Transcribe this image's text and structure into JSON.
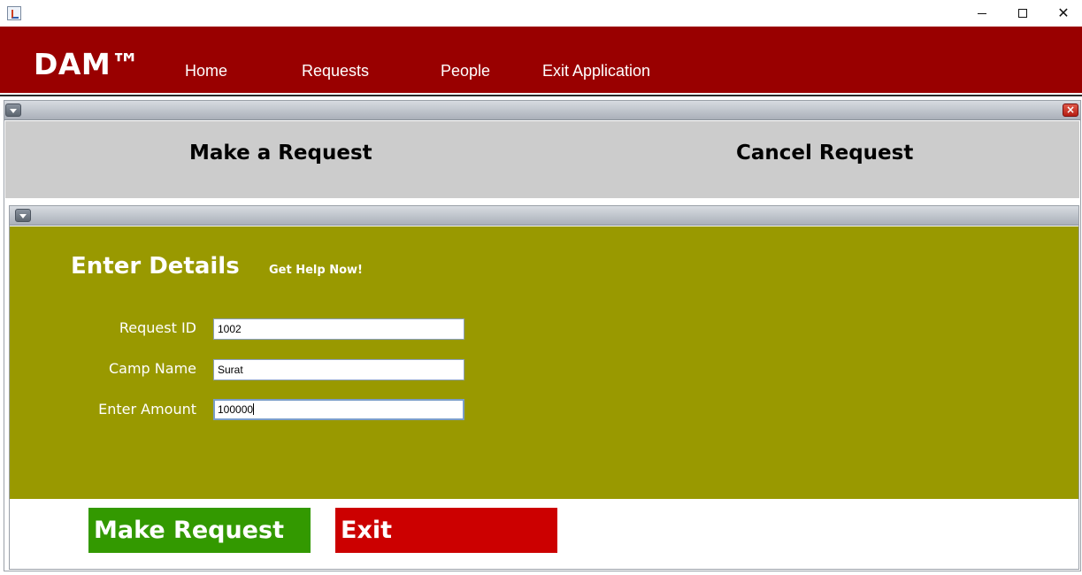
{
  "window": {
    "min_glyph": "",
    "max_glyph": "",
    "close_glyph": "✕"
  },
  "menubar": {
    "brand": "DAM™",
    "items": [
      {
        "label": "Home"
      },
      {
        "label": "Requests"
      },
      {
        "label": "People"
      },
      {
        "label": "Exit Application"
      }
    ],
    "background": "#990000"
  },
  "tabs": [
    {
      "label": "Make a Request"
    },
    {
      "label": "Cancel Request"
    }
  ],
  "form": {
    "heading": "Enter Details",
    "help_link": "Get Help Now!",
    "fields": [
      {
        "label": "Request ID",
        "value": "1002"
      },
      {
        "label": "Camp Name",
        "value": "Surat"
      },
      {
        "label": "Enter Amount",
        "value": "100000"
      }
    ],
    "background": "#999900"
  },
  "actions": {
    "make_request": "Make Request",
    "exit": "Exit",
    "make_color": "#339900",
    "exit_color": "#cc0000"
  }
}
